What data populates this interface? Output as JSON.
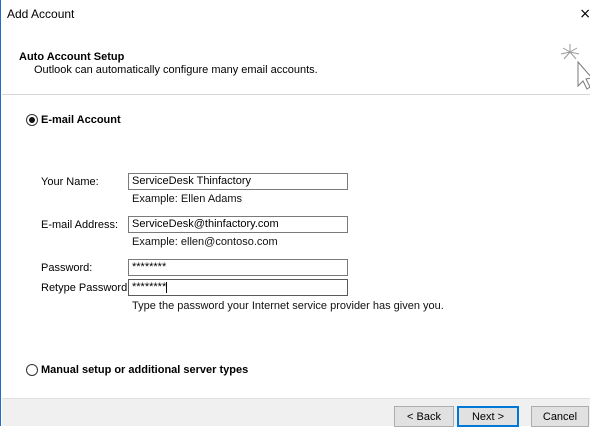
{
  "window": {
    "title": "Add Account",
    "close_glyph": "×"
  },
  "header": {
    "title": "Auto Account Setup",
    "subtitle": "Outlook can automatically configure many email accounts.",
    "icon": "cursor-sparkle-icon"
  },
  "options": {
    "email_account_label": "E-mail Account",
    "email_account_selected": true,
    "manual_setup_label": "Manual setup or additional server types",
    "manual_setup_selected": false
  },
  "form": {
    "name_label": "Your Name:",
    "name_value": "ServiceDesk Thinfactory",
    "name_hint": "Example: Ellen Adams",
    "email_label": "E-mail Address:",
    "email_value": "ServiceDesk@thinfactory.com",
    "email_hint": "Example: ellen@contoso.com",
    "password_label": "Password:",
    "password_value": "********",
    "retype_label": "Retype Password:",
    "retype_value": "********",
    "password_hint": "Type the password your Internet service provider has given you."
  },
  "buttons": {
    "back": "< Back",
    "next": "Next >",
    "cancel": "Cancel"
  },
  "colors": {
    "window_border": "#1e6fbf",
    "default_button_border": "#0078d7",
    "button_face": "#e1e1e1"
  }
}
